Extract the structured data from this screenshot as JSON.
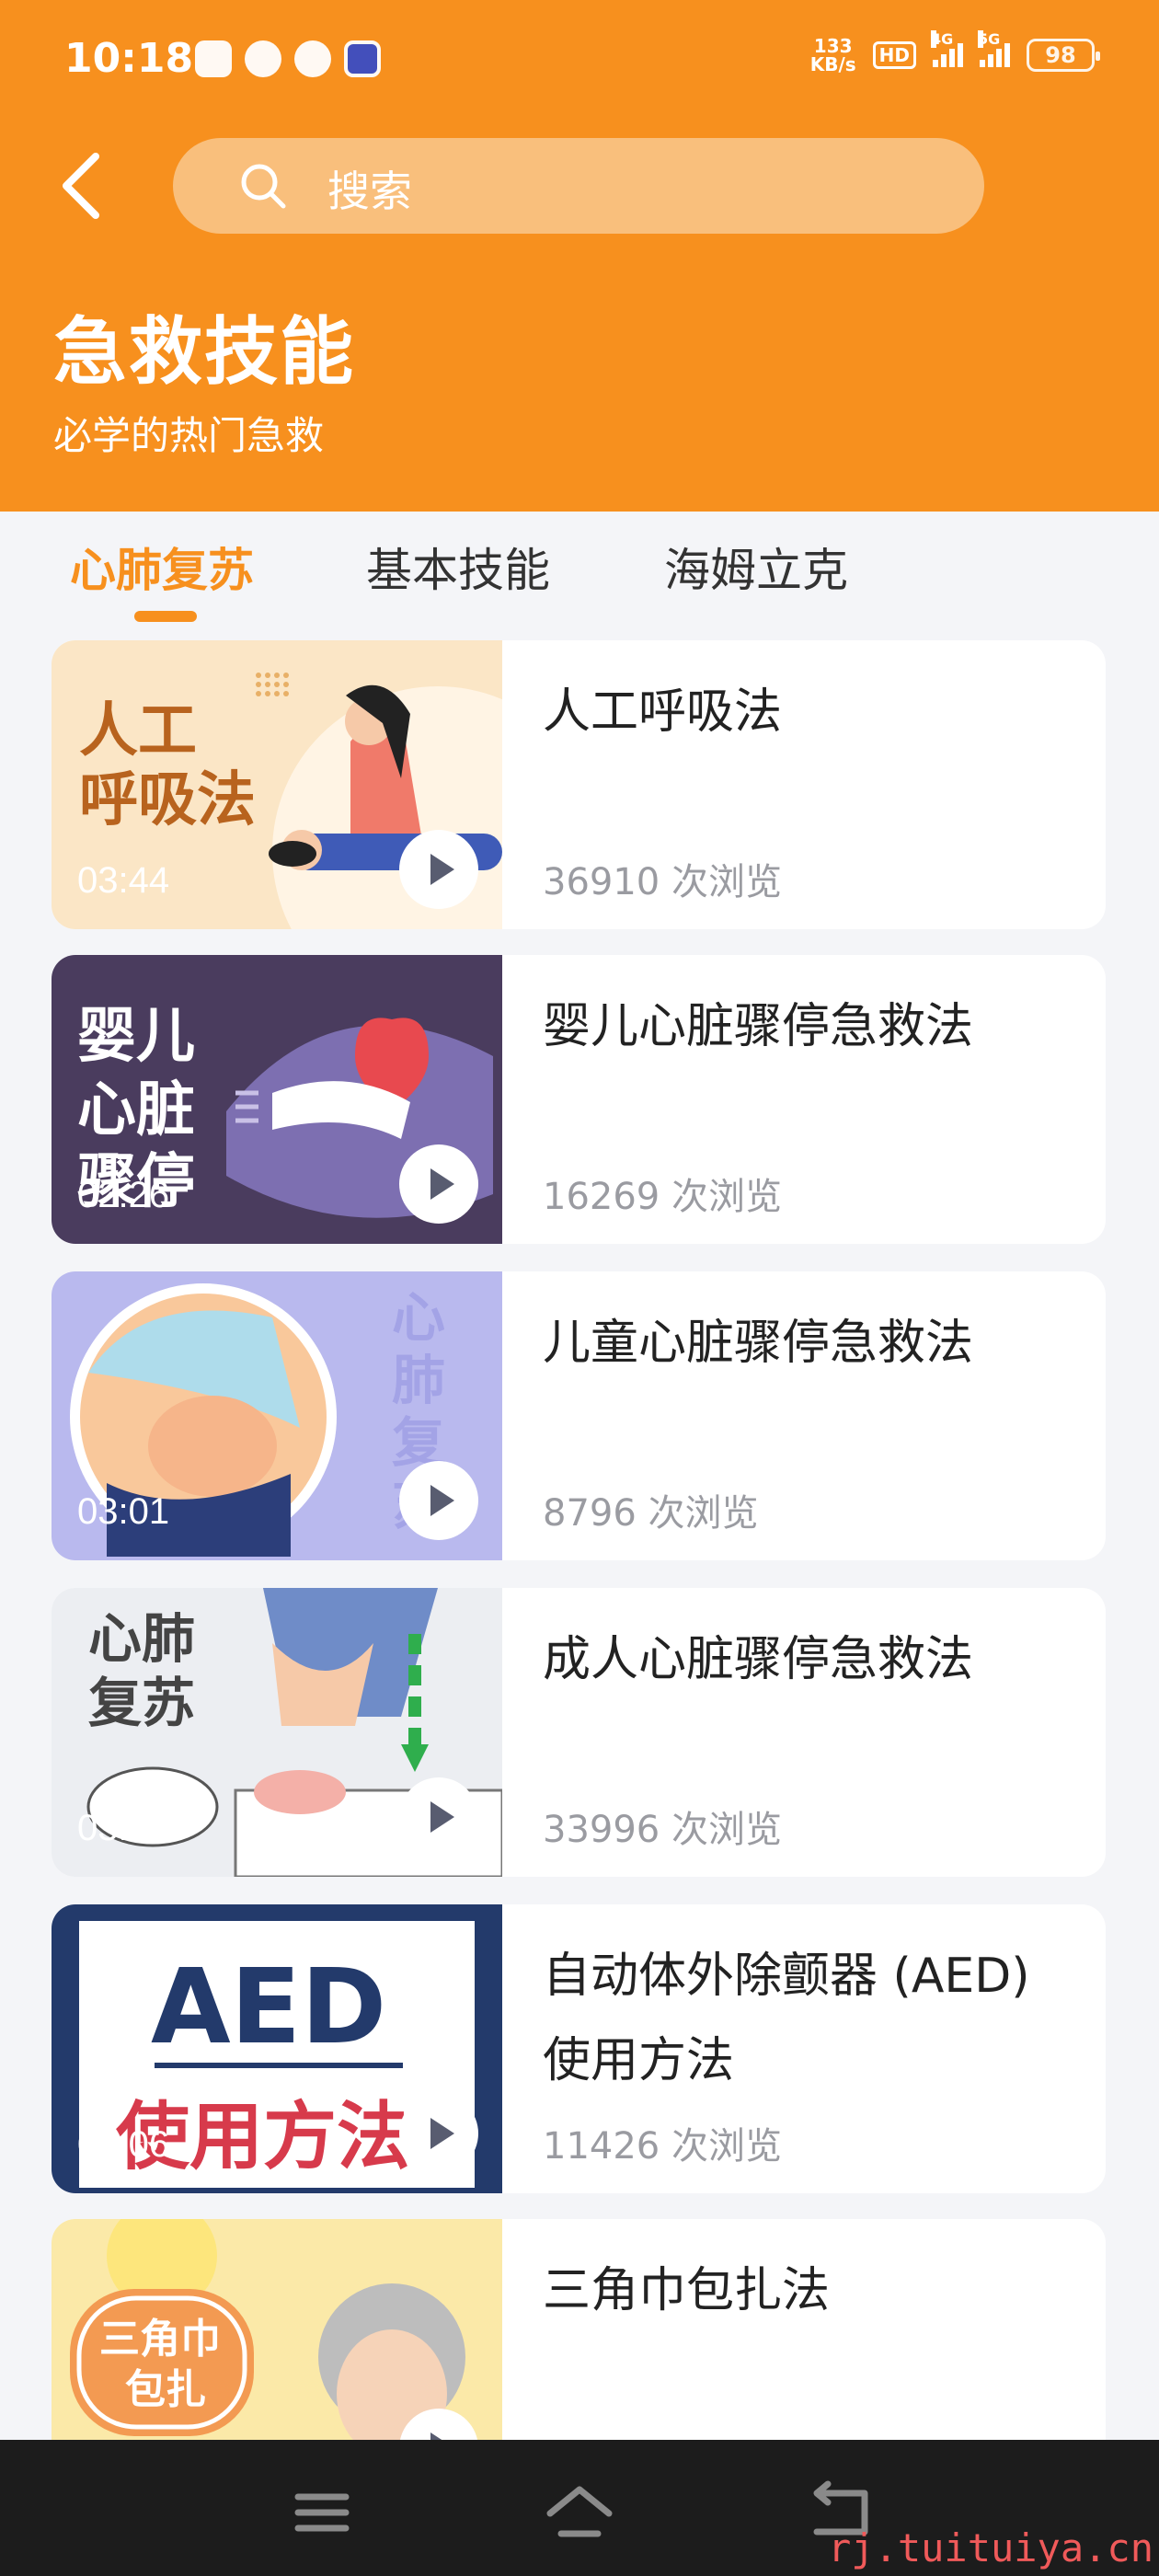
{
  "status_bar": {
    "time": "10:18",
    "net_speed_value": "133",
    "net_speed_unit": "KB/s",
    "hd_label": "HD",
    "signal_1": "4G",
    "signal_2": "5G",
    "battery": "98"
  },
  "search": {
    "placeholder": "搜索"
  },
  "header": {
    "title": "急救技能",
    "subtitle": "必学的热门急救"
  },
  "tabs": [
    {
      "label": "心肺复苏",
      "active": true
    },
    {
      "label": "基本技能",
      "active": false
    },
    {
      "label": "海姆立克",
      "active": false
    }
  ],
  "videos": [
    {
      "title": "人工呼吸法",
      "views": "36910 次浏览",
      "duration": "03:44",
      "thumb_text": "人工\n呼吸法"
    },
    {
      "title": "婴儿心脏骤停急救法",
      "views": "16269 次浏览",
      "duration": "02:26",
      "thumb_text": "婴儿\n心脏\n骤停"
    },
    {
      "title": "儿童心脏骤停急救法",
      "views": "8796 次浏览",
      "duration": "03:01",
      "thumb_text": "心肺复苏"
    },
    {
      "title": "成人心脏骤停急救法",
      "views": "33996 次浏览",
      "duration": "03:10",
      "thumb_text": "心肺\n复苏"
    },
    {
      "title": "自动体外除颤器 (AED) 使用方法",
      "views": "11426 次浏览",
      "duration": "02:06",
      "thumb_text": "AED\n使用方法"
    },
    {
      "title": "三角巾包扎法",
      "views": "",
      "duration": "",
      "thumb_text": "三角巾\n包扎"
    }
  ],
  "watermark": "rj.tuituiya.cn",
  "colors": {
    "accent": "#f7901e",
    "search_bg": "#f9bf7c",
    "page_bg": "#f4f5f8",
    "nav_bg": "#1c1c1c"
  },
  "icons": {
    "back": "chevron-left-icon",
    "search": "search-icon",
    "play": "play-icon",
    "nav_menu": "menu-icon",
    "nav_home": "home-icon",
    "nav_back": "return-icon"
  }
}
